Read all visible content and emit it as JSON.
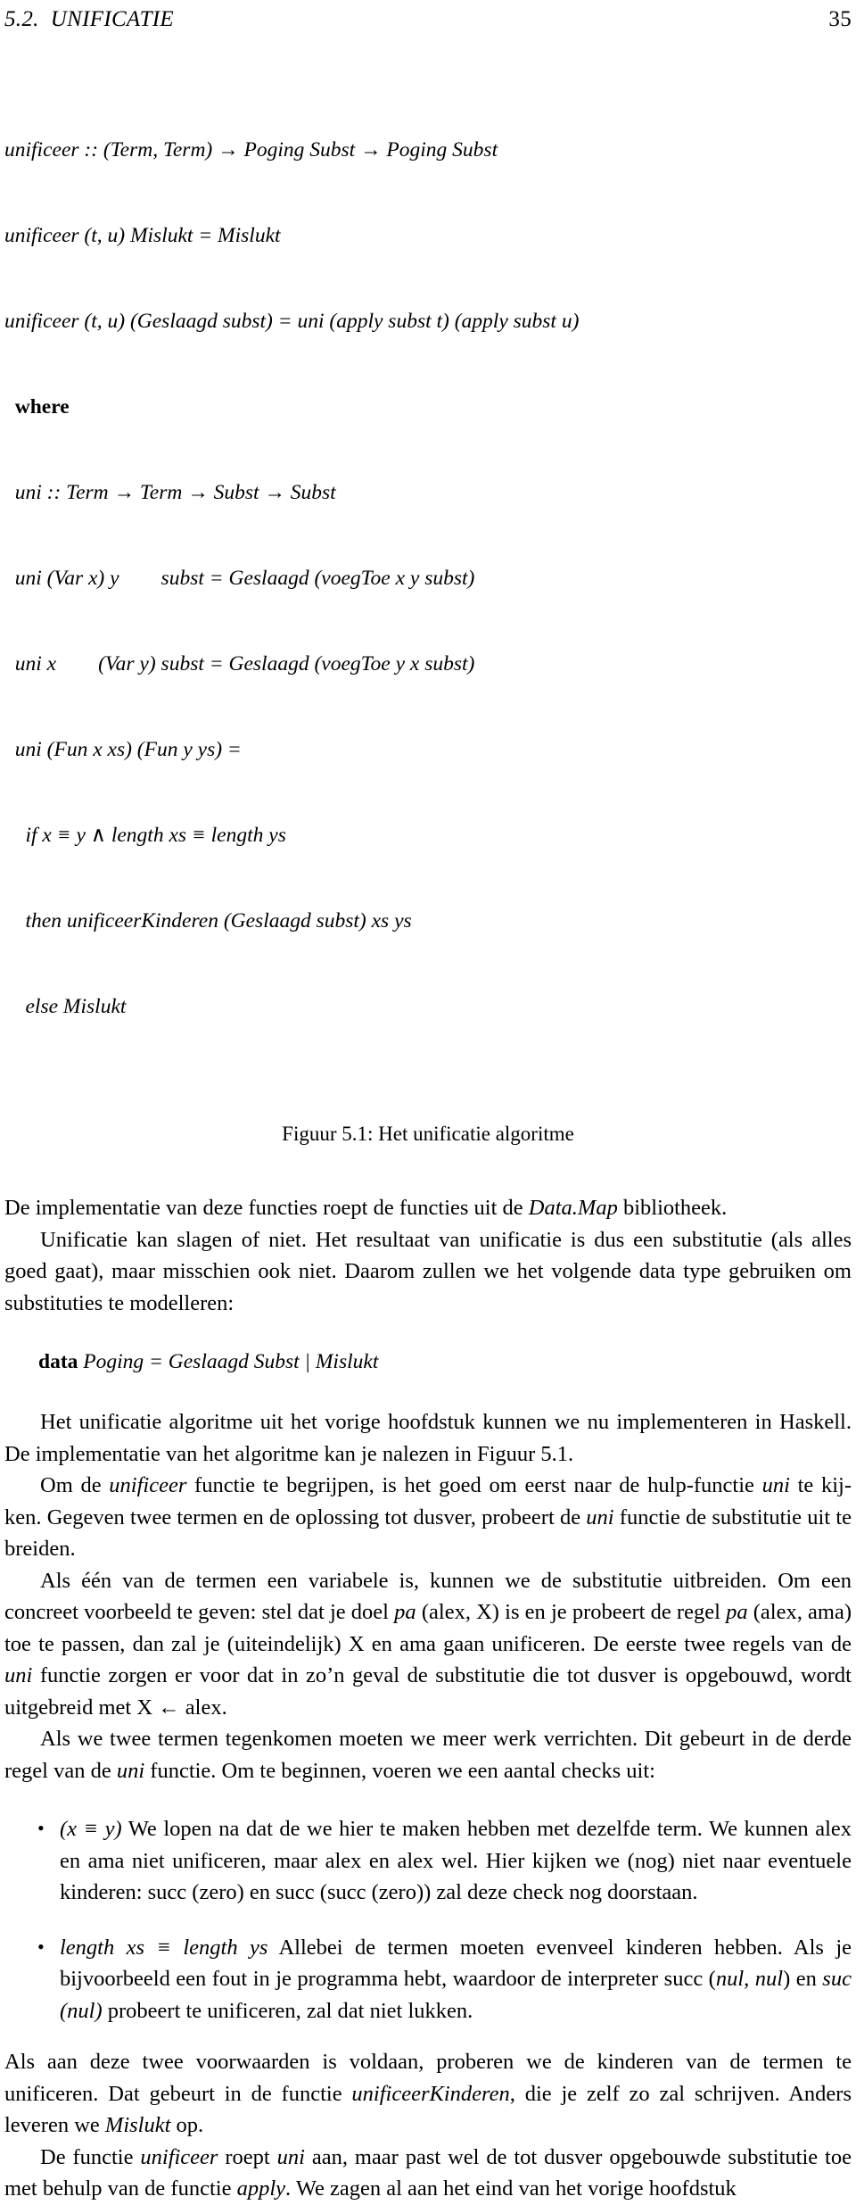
{
  "page": {
    "running_head_left": "5.2.  UNIFICATIE",
    "page_number": "35"
  },
  "figure": {
    "code_lines": [
      "unificeer :: (Term, Term) → Poging Subst → Poging Subst",
      "unificeer (t, u) Mislukt = Mislukt",
      "unificeer (t, u) (Geslaagd subst) = uni (apply subst t) (apply subst u)",
      "  where",
      "  uni :: Term → Term → Subst → Subst",
      "  uni (Var x) y        subst = Geslaagd (voegToe x y subst)",
      "  uni x        (Var y) subst = Geslaagd (voegToe y x subst)",
      "  uni (Fun x xs) (Fun y ys) =",
      "    if x ≡ y ∧ length xs ≡ length ys",
      "    then unificeerKinderen (Geslaagd subst) xs ys",
      "    else Mislukt"
    ],
    "caption": "Figuur 5.1: Het unificatie algoritme"
  },
  "body": {
    "para1_a": "De implementatie van deze functies roept de functies uit de ",
    "para1_em": "Data.Map",
    "para1_b": " bibliotheek.",
    "para2": "Unificatie kan slagen of niet. Het resultaat van unificatie is dus een substitutie (als alles goed gaat), maar misschien ook niet. Daarom zullen we het volgende data type gebruiken om substituties te modelleren:",
    "datatype_kw": "data",
    "datatype_rest": " Poging = Geslaagd Subst | Mislukt",
    "para3": "Het unificatie algoritme uit het vorige hoofdstuk kunnen we nu implementeren in Haskell. De implementatie van het algoritme kan je nalezen in Figuur 5.1.",
    "para4_a": "Om de ",
    "para4_em1": "unificeer",
    "para4_b": " functie te begrijpen, is het goed om eerst naar de hulp-functie ",
    "para4_em2": "uni",
    "para4_c": " te kij-ken. Gegeven twee termen en de oplossing tot dusver, probeert de ",
    "para4_em3": "uni",
    "para4_d": " functie de substitutie uit te breiden.",
    "para5_a": "Als één van de termen een variabele is, kunnen we de substitutie uitbreiden. Om een concreet voorbeeld te geven: stel dat je doel ",
    "para5_em1": "pa",
    "para5_b": " (alex, X) is en je probeert de regel ",
    "para5_em2": "pa",
    "para5_c": " (alex, ama) toe te passen, dan zal je (uiteindelijk) X en ama gaan unificeren. De eerste twee regels van de ",
    "para5_em3": "uni",
    "para5_d": " functie zorgen er voor dat in zo’n geval de substitutie die tot dusver is opgebouwd, wordt uitgebreid met X ← alex.",
    "para6_a": "Als we twee termen tegenkomen moeten we meer werk verrichten. Dit gebeurt in de derde regel van de ",
    "para6_em": "uni",
    "para6_b": " functie. Om te beginnen, voeren we een aantal checks uit:",
    "bullet_char": "•",
    "check1_math": "(x ≡ y)",
    "check1_text": " We lopen na dat de we hier te maken hebben met dezelfde term. We kunnen alex en ama niet unificeren, maar alex en alex wel. Hier kijken we (nog) niet naar eventuele kinderen: succ (zero) en succ (succ (zero)) zal deze check nog doorstaan.",
    "check2_math": "length xs ≡ length ys",
    "check2_a": " Allebei de termen moeten evenveel kinderen hebben. Als je bijvoorbeeld een fout in je programma hebt, waardoor de interpreter succ (",
    "check2_em1": "nul, nul",
    "check2_b": ") en ",
    "check2_em2": "suc (nul)",
    "check2_c": " probeert te unificeren, zal dat niet lukken.",
    "para7_a": "Als aan deze twee voorwaarden is voldaan, proberen we de kinderen van de termen te unificeren. Dat gebeurt in de functie ",
    "para7_em1": "unificeerKinderen",
    "para7_b": ", die je zelf zo zal schrijven. Anders leveren we ",
    "para7_em2": "Mislukt",
    "para7_c": " op.",
    "para8_a": "De functie ",
    "para8_em1": "unificeer",
    "para8_b": " roept ",
    "para8_em2": "uni",
    "para8_c": " aan, maar past wel de tot dusver opgebouwde substitutie toe met behulp van de functie ",
    "para8_em3": "apply",
    "para8_d": ". We zagen al aan het eind van het vorige hoofdstuk"
  }
}
